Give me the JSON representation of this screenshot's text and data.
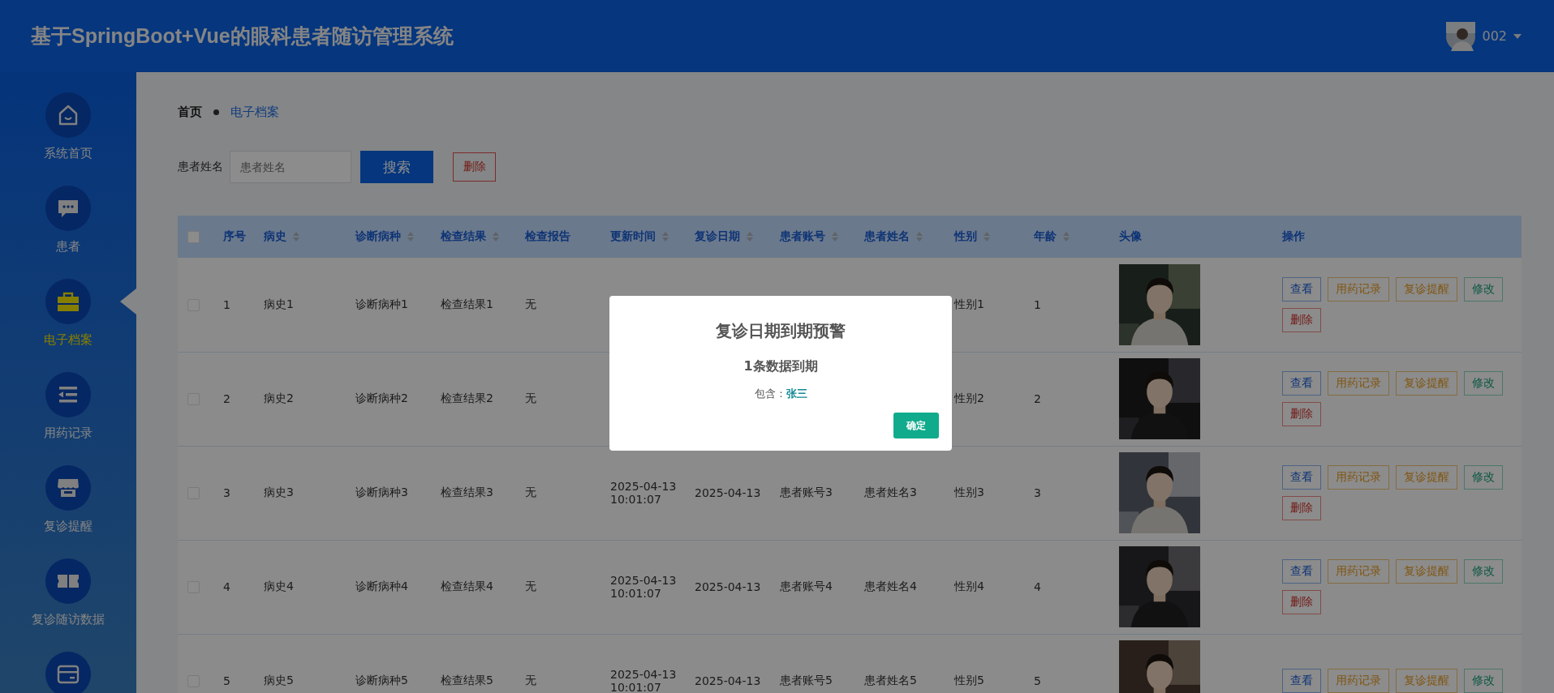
{
  "header": {
    "title": "基于SpringBoot+Vue的眼科患者随访管理系统",
    "user": {
      "name": "002"
    }
  },
  "sidebar": {
    "items": [
      {
        "label": "系统首页",
        "selected": false
      },
      {
        "label": "患者",
        "selected": false
      },
      {
        "label": "电子档案",
        "selected": true
      },
      {
        "label": "用药记录",
        "selected": false
      },
      {
        "label": "复诊提醒",
        "selected": false
      },
      {
        "label": "复诊随访数据",
        "selected": false
      },
      {
        "selected": false
      }
    ]
  },
  "breadcrumb": [
    "首页",
    "电子档案"
  ],
  "search": {
    "label": "患者姓名",
    "placeholder": "患者姓名",
    "buttons": [
      {
        "label": "搜索",
        "kind": "primary"
      },
      {
        "label": "删除",
        "kind": "danger"
      }
    ]
  },
  "table": {
    "all_checked": false,
    "columns": [
      {
        "label": "序号",
        "sortable": false
      },
      {
        "label": "病史",
        "sortable": true
      },
      {
        "label": "诊断病种",
        "sortable": true
      },
      {
        "label": "检查结果",
        "sortable": true
      },
      {
        "label": "检查报告",
        "sortable": false
      },
      {
        "label": "更新时间",
        "sortable": true
      },
      {
        "label": "复诊日期",
        "sortable": true
      },
      {
        "label": "患者账号",
        "sortable": true
      },
      {
        "label": "患者姓名",
        "sortable": true
      },
      {
        "label": "性别",
        "sortable": true
      },
      {
        "label": "年龄",
        "sortable": true
      },
      {
        "label": "头像",
        "sortable": false
      },
      {
        "label": "操作",
        "sortable": false
      }
    ],
    "rows": [
      {
        "checked": false,
        "cells": [
          "1",
          "病史1",
          "诊断病种1",
          "检查结果1",
          "无",
          null,
          null,
          null,
          null,
          "性别1",
          "1"
        ],
        "avatar": {
          "kind": "picture"
        },
        "actions": [
          {
            "label": "查看",
            "kind": "info"
          },
          {
            "label": "用药记录",
            "kind": "warning"
          },
          {
            "label": "复诊提醒",
            "kind": "warning"
          },
          {
            "label": "修改",
            "kind": "success"
          },
          {
            "label": "删除",
            "kind": "danger"
          }
        ]
      },
      {
        "checked": false,
        "cells": [
          "2",
          "病史2",
          "诊断病种2",
          "检查结果2",
          "无",
          null,
          null,
          null,
          null,
          "性别2",
          "2"
        ],
        "avatar": {
          "kind": "picture"
        },
        "actions": [
          {
            "label": "查看",
            "kind": "info"
          },
          {
            "label": "用药记录",
            "kind": "warning"
          },
          {
            "label": "复诊提醒",
            "kind": "warning"
          },
          {
            "label": "修改",
            "kind": "success"
          },
          {
            "label": "删除",
            "kind": "danger"
          }
        ]
      },
      {
        "checked": false,
        "cells": [
          "3",
          "病史3",
          "诊断病种3",
          "检查结果3",
          "无",
          "2025-04-13 10:01:07",
          "2025-04-13",
          "患者账号3",
          "患者姓名3",
          "性别3",
          "3"
        ],
        "avatar": {
          "kind": "picture"
        },
        "actions": [
          {
            "label": "查看",
            "kind": "info"
          },
          {
            "label": "用药记录",
            "kind": "warning"
          },
          {
            "label": "复诊提醒",
            "kind": "warning"
          },
          {
            "label": "修改",
            "kind": "success"
          },
          {
            "label": "删除",
            "kind": "danger"
          }
        ]
      },
      {
        "checked": false,
        "cells": [
          "4",
          "病史4",
          "诊断病种4",
          "检查结果4",
          "无",
          "2025-04-13 10:01:07",
          "2025-04-13",
          "患者账号4",
          "患者姓名4",
          "性别4",
          "4"
        ],
        "avatar": {
          "kind": "picture"
        },
        "actions": [
          {
            "label": "查看",
            "kind": "info"
          },
          {
            "label": "用药记录",
            "kind": "warning"
          },
          {
            "label": "复诊提醒",
            "kind": "warning"
          },
          {
            "label": "修改",
            "kind": "success"
          },
          {
            "label": "删除",
            "kind": "danger"
          }
        ]
      },
      {
        "checked": false,
        "cells": [
          "5",
          "病史5",
          "诊断病种5",
          "检查结果5",
          "无",
          "2025-04-13 10:01:07",
          "2025-04-13",
          "患者账号5",
          "患者姓名5",
          "性别5",
          "5"
        ],
        "avatar": {
          "kind": "picture"
        },
        "actions": [
          {
            "label": "查看",
            "kind": "info"
          },
          {
            "label": "用药记录",
            "kind": "warning"
          },
          {
            "label": "复诊提醒",
            "kind": "warning"
          },
          {
            "label": "修改",
            "kind": "success"
          }
        ]
      }
    ]
  },
  "dialog": {
    "title": "复诊日期到期预警",
    "message": "1条数据到期",
    "detail_label": "包含：",
    "detail_names": "张三",
    "button": "确定"
  }
}
